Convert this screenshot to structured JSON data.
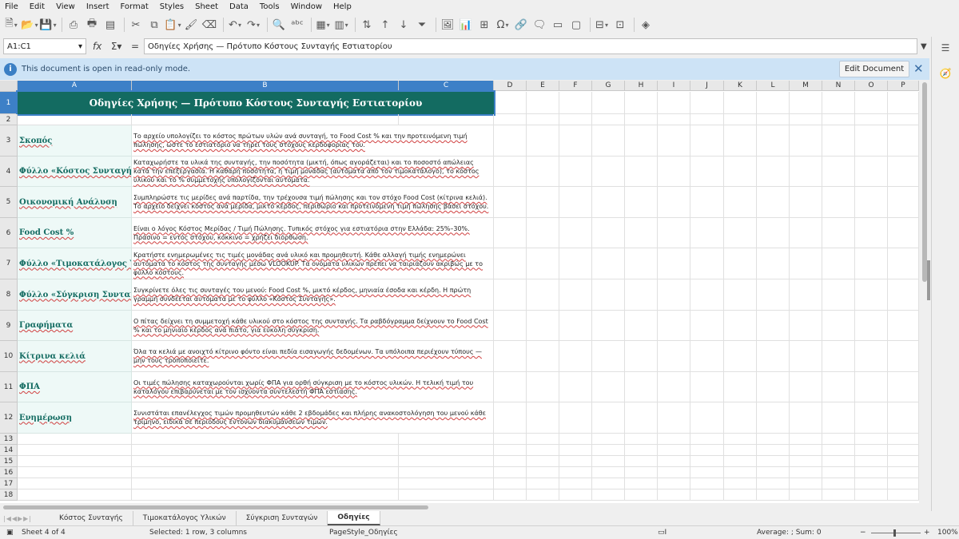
{
  "menu": [
    "File",
    "Edit",
    "View",
    "Insert",
    "Format",
    "Styles",
    "Sheet",
    "Data",
    "Tools",
    "Window",
    "Help"
  ],
  "formula_bar": {
    "name_box": "A1:C1",
    "content": "Οδηγίες Χρήσης — Πρότυπο Κόστους Συνταγής Εστιατορίου"
  },
  "infobar": {
    "message": "This document is open in read-only mode.",
    "button": "Edit Document"
  },
  "columns": [
    "A",
    "B",
    "C",
    "D",
    "E",
    "F",
    "G",
    "H",
    "I",
    "J",
    "K",
    "L",
    "M",
    "N",
    "O",
    "P"
  ],
  "selected_columns": [
    "A",
    "B",
    "C"
  ],
  "sheet": {
    "title": "Οδηγίες Χρήσης — Πρότυπο Κόστους Συνταγής Εστιατορίου",
    "rows": [
      {
        "row": "3",
        "label": "Σκοπός",
        "text": "Το αρχείο υπολογίζει το κόστος πρώτων υλών ανά συνταγή, το Food Cost % και την προτεινόμενη τιμή πώλησης, ώστε το εστιατόριο να τηρεί τους στόχους κερδοφορίας του."
      },
      {
        "row": "4",
        "label": "Φύλλο «Κόστος Συνταγής»",
        "text": "Καταχωρήστε τα υλικά της συνταγής, την ποσότητα (μικτή, όπως αγοράζεται) και το ποσοστό απώλειας κατά την επεξεργασία. Η καθαρή ποσότητα, η τιμή μονάδας (αυτόματα από τον τιμοκατάλογο), το κόστος υλικού και το % συμμετοχής υπολογίζονται αυτόματα."
      },
      {
        "row": "5",
        "label": "Οικονομική Ανάλυση",
        "text": "Συμπληρώστε τις μερίδες ανά παρτίδα, την τρέχουσα τιμή πώλησης και τον στόχο Food Cost (κίτρινα κελιά). Το αρχείο δείχνει κόστος ανά μερίδα, μικτό κέρδος, περιθώριο και προτεινόμενη τιμή πώλησης βάσει στόχου."
      },
      {
        "row": "6",
        "label": "Food Cost %",
        "text": "Είναι ο λόγος Κόστος Μερίδας / Τιμή Πώλησης. Τυπικός στόχος για εστιατόρια στην Ελλάδα: 25%–30%. Πράσινο = εντός στόχου, κόκκινο = χρήζει διόρθωση."
      },
      {
        "row": "7",
        "label": "Φύλλο «Τιμοκατάλογος Υλικών»",
        "text": "Κρατήστε ενημερωμένες τις τιμές μονάδας ανά υλικό και προμηθευτή. Κάθε αλλαγή τιμής ενημερώνει αυτόματα το κόστος της συνταγής μέσω VLOOKUP. Τα ονόματα υλικών πρέπει να ταιριάζουν ακριβώς με το φύλλο κόστους."
      },
      {
        "row": "8",
        "label": "Φύλλο «Σύγκριση Συνταγών»",
        "text": "Συγκρίνετε όλες τις συνταγές του μενού: Food Cost %, μικτό κέρδος, μηνιαία έσοδα και κέρδη. Η πρώτη γραμμή συνδέεται αυτόματα με το φύλλο «Κόστος Συνταγής»."
      },
      {
        "row": "9",
        "label": "Γραφήματα",
        "text": "Ο πίτας δείχνει τη συμμετοχή κάθε υλικού στο κόστος της συνταγής. Τα ραβδόγραμμα δείχνουν το Food Cost % και το μηνιαίο κέρδος ανά πιάτο, για εύκολη σύγκριση."
      },
      {
        "row": "10",
        "label": "Κίτρινα κελιά",
        "text": "Όλα τα κελιά με ανοιχτό κίτρινο φόντο είναι πεδία εισαγωγής δεδομένων. Τα υπόλοιπα περιέχουν τύπους — μην τους τροποποιείτε."
      },
      {
        "row": "11",
        "label": "ΦΠΑ",
        "text": "Οι τιμές πώλησης καταχωρούνται χωρίς ΦΠΑ για ορθή σύγκριση με το κόστος υλικών. Η τελική τιμή του καταλόγου επιβαρύνεται με τον ισχύοντα συντελεστή ΦΠΑ εστίασης."
      },
      {
        "row": "12",
        "label": "Ενημέρωση",
        "text": "Συνιστάται επανέλεγχος τιμών προμηθευτών κάθε 2 εβδομάδες και πλήρης ανακοστολόγηση του μενού κάθε τρίμηνο, ειδικά σε περιόδους έντονων διακυμάνσεων τιμών."
      }
    ],
    "row_numbers_top": [
      "1",
      "2"
    ],
    "empty_rows": [
      "13",
      "14",
      "15",
      "16",
      "17",
      "18"
    ]
  },
  "tabs": [
    "Κόστος Συνταγής",
    "Τιμοκατάλογος Υλικών",
    "Σύγκριση Συνταγών",
    "Οδηγίες"
  ],
  "active_tab": "Οδηγίες",
  "status": {
    "sheet": "Sheet 4 of 4",
    "selection": "Selected: 1 row, 3 columns",
    "page_style": "PageStyle_Οδηγίες",
    "summary": "Average: ; Sum: 0",
    "zoom": "100%"
  },
  "colors": {
    "title_bg": "#136b61",
    "label_bg": "#eef9f7",
    "selection": "#3d80c7",
    "infobar_bg": "#cde3f6"
  }
}
